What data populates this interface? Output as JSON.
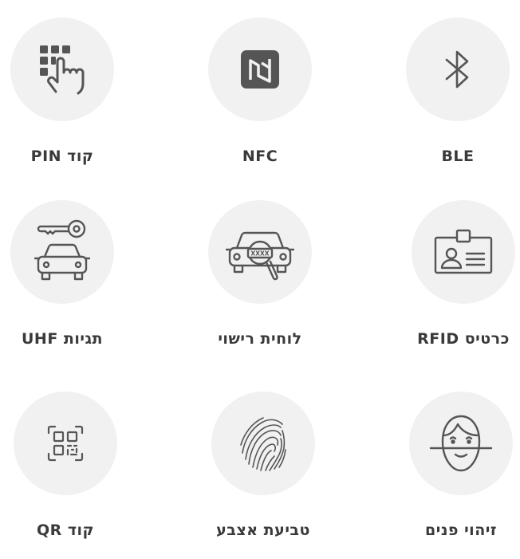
{
  "methods": [
    {
      "id": "pin",
      "label": "קוד PIN",
      "icon": "keypad-hand-icon"
    },
    {
      "id": "nfc",
      "label": "NFC",
      "icon": "nfc-icon"
    },
    {
      "id": "ble",
      "label": "BLE",
      "icon": "bluetooth-icon"
    },
    {
      "id": "uhf",
      "label": "תגיות UHF",
      "icon": "car-key-icon"
    },
    {
      "id": "lpr",
      "label": "לוחית רישוי",
      "icon": "license-plate-search-icon"
    },
    {
      "id": "rfid",
      "label": "כרטיס RFID",
      "icon": "id-card-icon"
    },
    {
      "id": "qr",
      "label": "קוד QR",
      "icon": "qr-code-icon"
    },
    {
      "id": "fingerprint",
      "label": "טביעת אצבע",
      "icon": "fingerprint-icon"
    },
    {
      "id": "face",
      "label": "זיהוי פנים",
      "icon": "face-recognition-icon"
    }
  ],
  "colors": {
    "icon": "#555555",
    "circle": "#f1f1f1",
    "label": "#3a3a3a"
  }
}
